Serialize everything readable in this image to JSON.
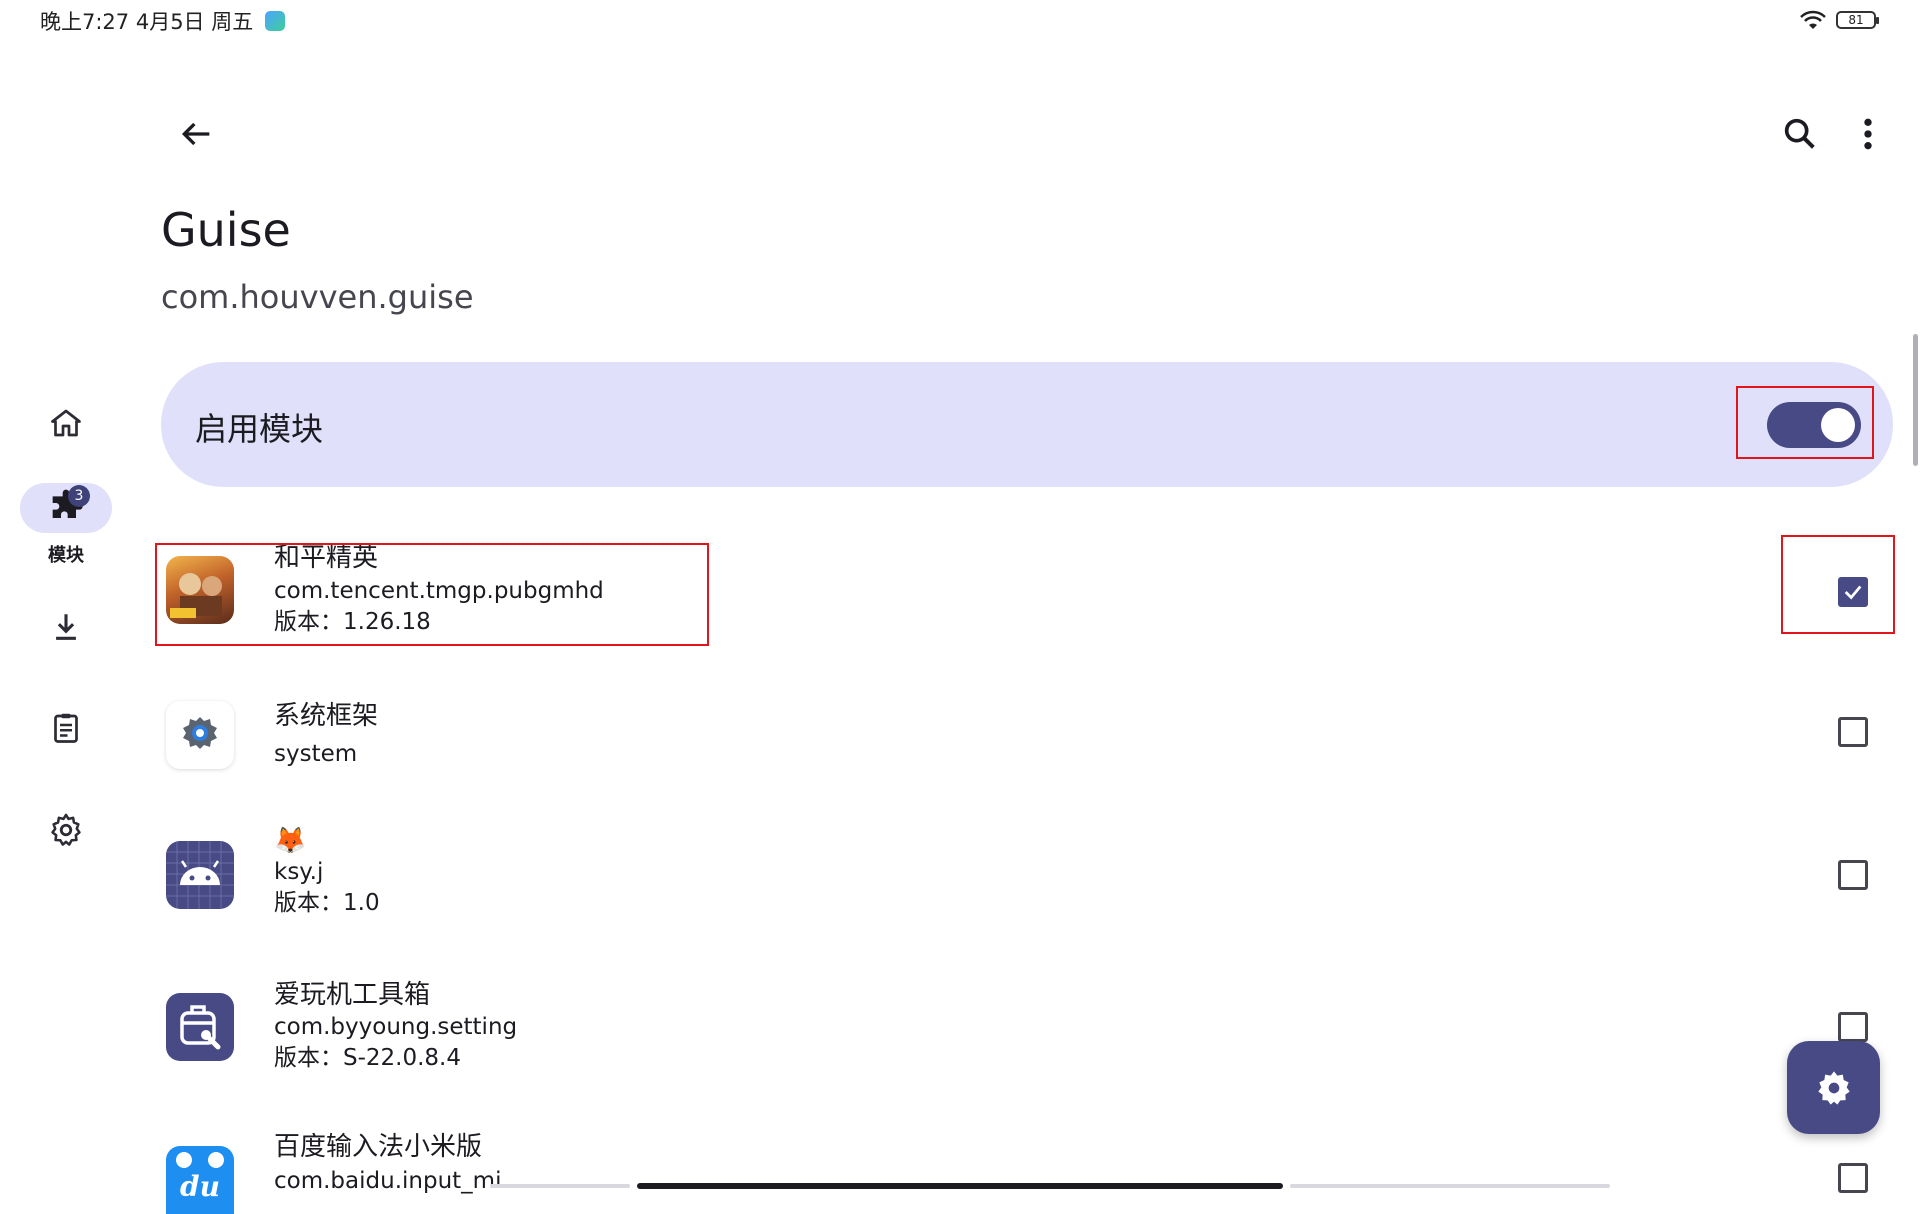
{
  "status_bar": {
    "time_date": "晚上7:27 4月5日 周五",
    "battery": "81"
  },
  "nav_rail": {
    "items": [
      {
        "icon": "home-icon"
      },
      {
        "icon": "puzzle-icon",
        "label": "模块",
        "badge": "3",
        "active": true
      },
      {
        "icon": "download-icon"
      },
      {
        "icon": "clipboard-icon"
      },
      {
        "icon": "gear-icon"
      }
    ]
  },
  "header": {
    "title": "Guise",
    "subtitle": "com.houvven.guise"
  },
  "enable_card": {
    "label": "启用模块",
    "enabled": true
  },
  "apps": [
    {
      "name": "和平精英",
      "package": "com.tencent.tmgp.pubgmhd",
      "version": "版本：1.26.18",
      "checked": true,
      "icon": "pubg-app-icon"
    },
    {
      "name": "系统框架",
      "package": "system",
      "version": "",
      "checked": false,
      "icon": "system-framework-icon"
    },
    {
      "name": "🦊",
      "package": "ksy.j",
      "version": "版本：1.0",
      "checked": false,
      "icon": "android-app-icon"
    },
    {
      "name": "爱玩机工具箱",
      "package": "com.byyoung.setting",
      "version": "版本：S-22.0.8.4",
      "checked": false,
      "icon": "toolbox-app-icon"
    },
    {
      "name": "百度输入法小米版",
      "package": "com.baidu.input_mi",
      "version": "",
      "checked": false,
      "icon": "baidu-input-icon"
    }
  ],
  "colors": {
    "accent": "#474a84",
    "card_bg": "#e0e0fb",
    "highlight": "#e0161c"
  }
}
